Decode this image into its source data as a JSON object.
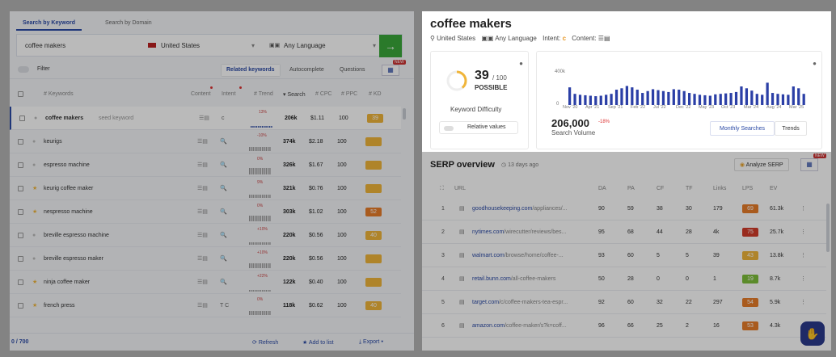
{
  "left": {
    "tabs": [
      {
        "label": "Search by Keyword"
      },
      {
        "label": "Search by Domain"
      }
    ],
    "search": {
      "keyword": "coffee makers",
      "country": "United States",
      "language": "Any Language",
      "go": "→"
    },
    "filter": "Filter",
    "pills": [
      "Related keywords",
      "Autocomplete",
      "Questions"
    ],
    "new_badge": "NEW",
    "headers": {
      "keywords": "# Keywords",
      "content": "Content",
      "intent": "Intent",
      "trend": "# Trend",
      "search": "Search",
      "cpc": "# CPC",
      "ppc": "# PPC",
      "kd": "# KD"
    },
    "rows": [
      {
        "keyword": "coffee makers",
        "seed": "seed keyword",
        "intent": "c",
        "trend": "13%",
        "search": "206k",
        "cpc": "$1.11",
        "ppc": "100",
        "kd": "39",
        "kd_color": "#f0b53a",
        "star": false
      },
      {
        "keyword": "keurigs",
        "seed": "",
        "intent": "🔍",
        "trend": "-10%",
        "search": "374k",
        "cpc": "$2.18",
        "ppc": "100",
        "kd": "",
        "kd_color": "#f0b53a",
        "star": false
      },
      {
        "keyword": "espresso machine",
        "seed": "",
        "intent": "🔍",
        "trend": "0%",
        "search": "326k",
        "cpc": "$1.67",
        "ppc": "100",
        "kd": "",
        "kd_color": "#f0b53a",
        "star": false
      },
      {
        "keyword": "keurig coffee maker",
        "seed": "",
        "intent": "🔍",
        "trend": "9%",
        "search": "321k",
        "cpc": "$0.76",
        "ppc": "100",
        "kd": "",
        "kd_color": "#f0b53a",
        "star": true
      },
      {
        "keyword": "nespresso machine",
        "seed": "",
        "intent": "🔍",
        "trend": "0%",
        "search": "303k",
        "cpc": "$1.02",
        "ppc": "100",
        "kd": "52",
        "kd_color": "#e87d2a",
        "star": true
      },
      {
        "keyword": "breville espresso machine",
        "seed": "",
        "intent": "🔍",
        "trend": "+10%",
        "search": "220k",
        "cpc": "$0.56",
        "ppc": "100",
        "kd": "40",
        "kd_color": "#f0b53a",
        "star": false
      },
      {
        "keyword": "breville espresso maker",
        "seed": "",
        "intent": "🔍",
        "trend": "+10%",
        "search": "220k",
        "cpc": "$0.56",
        "ppc": "100",
        "kd": "",
        "kd_color": "#f0b53a",
        "star": false
      },
      {
        "keyword": "ninja coffee maker",
        "seed": "",
        "intent": "🔍",
        "trend": "+22%",
        "search": "122k",
        "cpc": "$0.40",
        "ppc": "100",
        "kd": "",
        "kd_color": "#f0b53a",
        "star": true
      },
      {
        "keyword": "french press",
        "seed": "",
        "intent": "T C",
        "trend": "0%",
        "search": "118k",
        "cpc": "$0.62",
        "ppc": "100",
        "kd": "40",
        "kd_color": "#f0b53a",
        "star": true
      }
    ],
    "footer": {
      "count": "0 / 700",
      "refresh": "Refresh",
      "add": "Add to list",
      "export": "Export"
    }
  },
  "right": {
    "title": "coffee makers",
    "meta": {
      "country": "United States",
      "language": "Any Language",
      "intent_label": "Intent:",
      "intent": "c",
      "content_label": "Content:"
    },
    "kd": {
      "value": "39",
      "max": "/ 100",
      "label": "POSSIBLE",
      "caption": "Keyword Difficulty",
      "relative": "Relative values",
      "fraction": 0.39
    },
    "volume": {
      "value": "206,000",
      "change": "-18%",
      "caption": "Search Volume",
      "ymax": "400k",
      "ymin": "0",
      "monthly": "Monthly Searches",
      "trends": "Trends",
      "xlabels": [
        "Nov '20",
        "Apr '21",
        "Sep '21",
        "Feb '22",
        "Jul '22",
        "Dec '22",
        "May '23",
        "Oct '23",
        "Mar '24",
        "Aug '24",
        "Mar '25"
      ],
      "bars": [
        190,
        120,
        110,
        105,
        100,
        95,
        100,
        110,
        120,
        165,
        180,
        205,
        190,
        165,
        130,
        150,
        170,
        160,
        150,
        140,
        170,
        165,
        150,
        130,
        120,
        110,
        105,
        100,
        115,
        120,
        125,
        130,
        140,
        200,
        180,
        155,
        120,
        110,
        240,
        130,
        120,
        115,
        110,
        200,
        180,
        120
      ]
    },
    "serp": {
      "title": "SERP overview",
      "age": "13 days ago",
      "analyze": "Analyze SERP",
      "new_badge": "NEW",
      "headers": [
        "URL",
        "DA",
        "PA",
        "CF",
        "TF",
        "Links",
        "LPS",
        "EV"
      ],
      "rows": [
        {
          "n": "1",
          "domain": "goodhousekeeping.com",
          "path": "/appliances/...",
          "da": "90",
          "pa": "59",
          "cf": "38",
          "tf": "30",
          "links": "179",
          "lps": "69",
          "lps_color": "#e87d2a",
          "ev": "61.3k"
        },
        {
          "n": "2",
          "domain": "nytimes.com",
          "path": "/wirecutter/reviews/bes...",
          "da": "95",
          "pa": "68",
          "cf": "44",
          "tf": "28",
          "links": "4k",
          "lps": "75",
          "lps_color": "#d23b2a",
          "ev": "25.7k"
        },
        {
          "n": "3",
          "domain": "walmart.com",
          "path": "/browse/home/coffee-...",
          "da": "93",
          "pa": "60",
          "cf": "5",
          "tf": "5",
          "links": "39",
          "lps": "43",
          "lps_color": "#f0b53a",
          "ev": "13.8k"
        },
        {
          "n": "4",
          "domain": "retail.bunn.com",
          "path": "/all-coffee-makers",
          "da": "50",
          "pa": "28",
          "cf": "0",
          "tf": "0",
          "links": "1",
          "lps": "19",
          "lps_color": "#7dbf3a",
          "ev": "8.7k"
        },
        {
          "n": "5",
          "domain": "target.com",
          "path": "/c/coffee-makers-tea-espr...",
          "da": "92",
          "pa": "60",
          "cf": "32",
          "tf": "22",
          "links": "297",
          "lps": "54",
          "lps_color": "#e87d2a",
          "ev": "5.9k"
        },
        {
          "n": "6",
          "domain": "amazon.com",
          "path": "/coffee-maker/s?k=coff...",
          "da": "96",
          "pa": "66",
          "cf": "25",
          "tf": "2",
          "links": "16",
          "lps": "53",
          "lps_color": "#e87d2a",
          "ev": "4.3k"
        }
      ]
    }
  }
}
